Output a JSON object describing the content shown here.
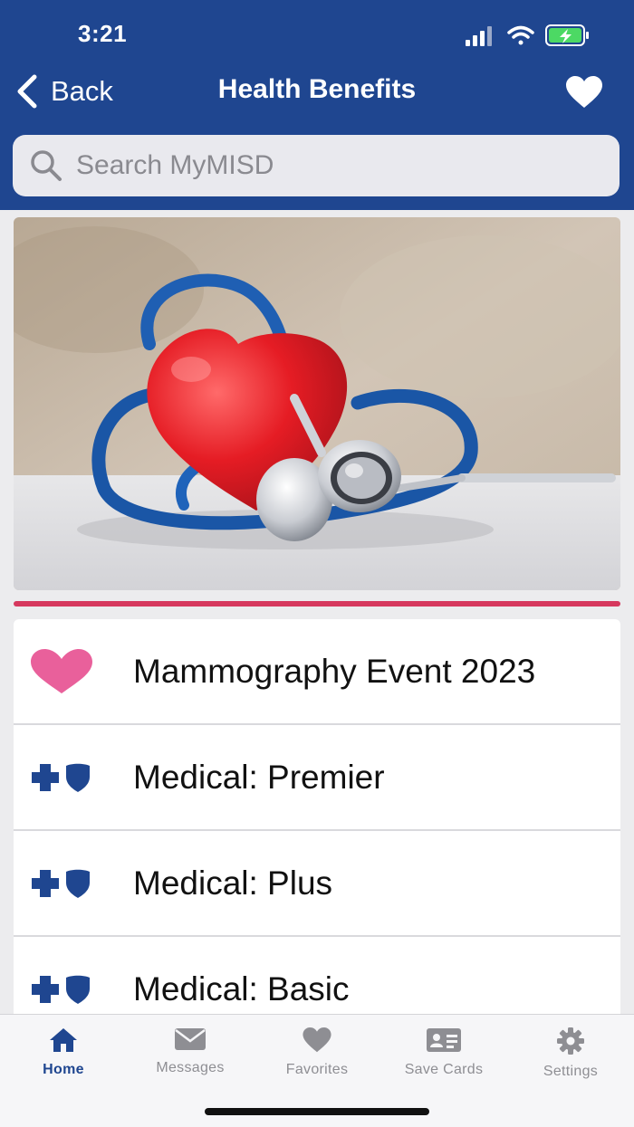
{
  "status_bar": {
    "time": "3:21"
  },
  "nav": {
    "back_label": "Back",
    "title": "Health Benefits",
    "favorite_icon": "heart-icon"
  },
  "search": {
    "placeholder": "Search MyMISD",
    "value": ""
  },
  "hero": {
    "image": "heart-and-stethoscope-photo"
  },
  "colors": {
    "header": "#1f4690",
    "accent": "#d6385e",
    "pink_heart": "#e9609b",
    "bcbs_blue": "#1f4690",
    "tab_active": "#1f4690",
    "tab_inactive": "#8e8e93"
  },
  "list": {
    "items": [
      {
        "label": "Mammography Event 2023",
        "icon": "pink-heart-icon"
      },
      {
        "label": "Medical: Premier",
        "icon": "cross-shield-icon"
      },
      {
        "label": "Medical: Plus",
        "icon": "cross-shield-icon"
      },
      {
        "label": "Medical: Basic",
        "icon": "cross-shield-icon"
      }
    ]
  },
  "tabbar": {
    "tabs": [
      {
        "label": "Home",
        "icon": "home-icon",
        "active": true
      },
      {
        "label": "Messages",
        "icon": "envelope-icon",
        "active": false
      },
      {
        "label": "Favorites",
        "icon": "heart-icon",
        "active": false
      },
      {
        "label": "Save Cards",
        "icon": "id-card-icon",
        "active": false
      },
      {
        "label": "Settings",
        "icon": "gear-icon",
        "active": false
      }
    ]
  }
}
